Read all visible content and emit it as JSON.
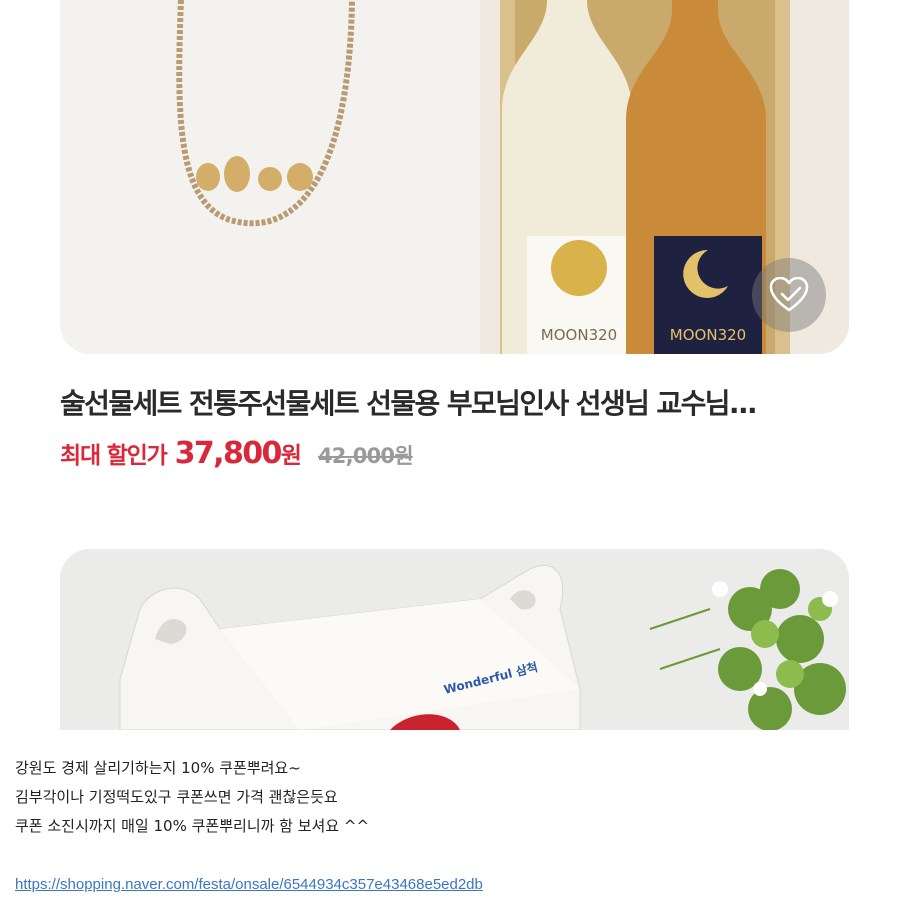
{
  "product": {
    "title": "술선물세트 전통주선물세트 선물용 부모님인사 선생님 교수님...",
    "price_label": "최대 할인가",
    "price": "37,800",
    "price_unit": "원",
    "original_price": "42,000원",
    "wish_icon": "heart-check-icon",
    "bottle_labels": [
      "MOON320",
      "MOON320"
    ]
  },
  "second_product": {
    "box_brand": "Wonderful 삼척"
  },
  "post": {
    "lines": [
      "강원도 경제 살리기하는지 10% 쿠폰뿌려요~",
      "김부각이나 기정떡도있구 쿠폰쓰면 가격 괜찮은듯요",
      "쿠폰 소진시까지 매일 10% 쿠폰뿌리니까 함 보셔요 ^^"
    ],
    "link": "https://shopping.naver.com/festa/onsale/6544934c357e43468e5ed2db"
  },
  "colors": {
    "sale_red": "#d8283a",
    "link_blue": "#3a76c5",
    "strike_gray": "#9a9a9a"
  }
}
